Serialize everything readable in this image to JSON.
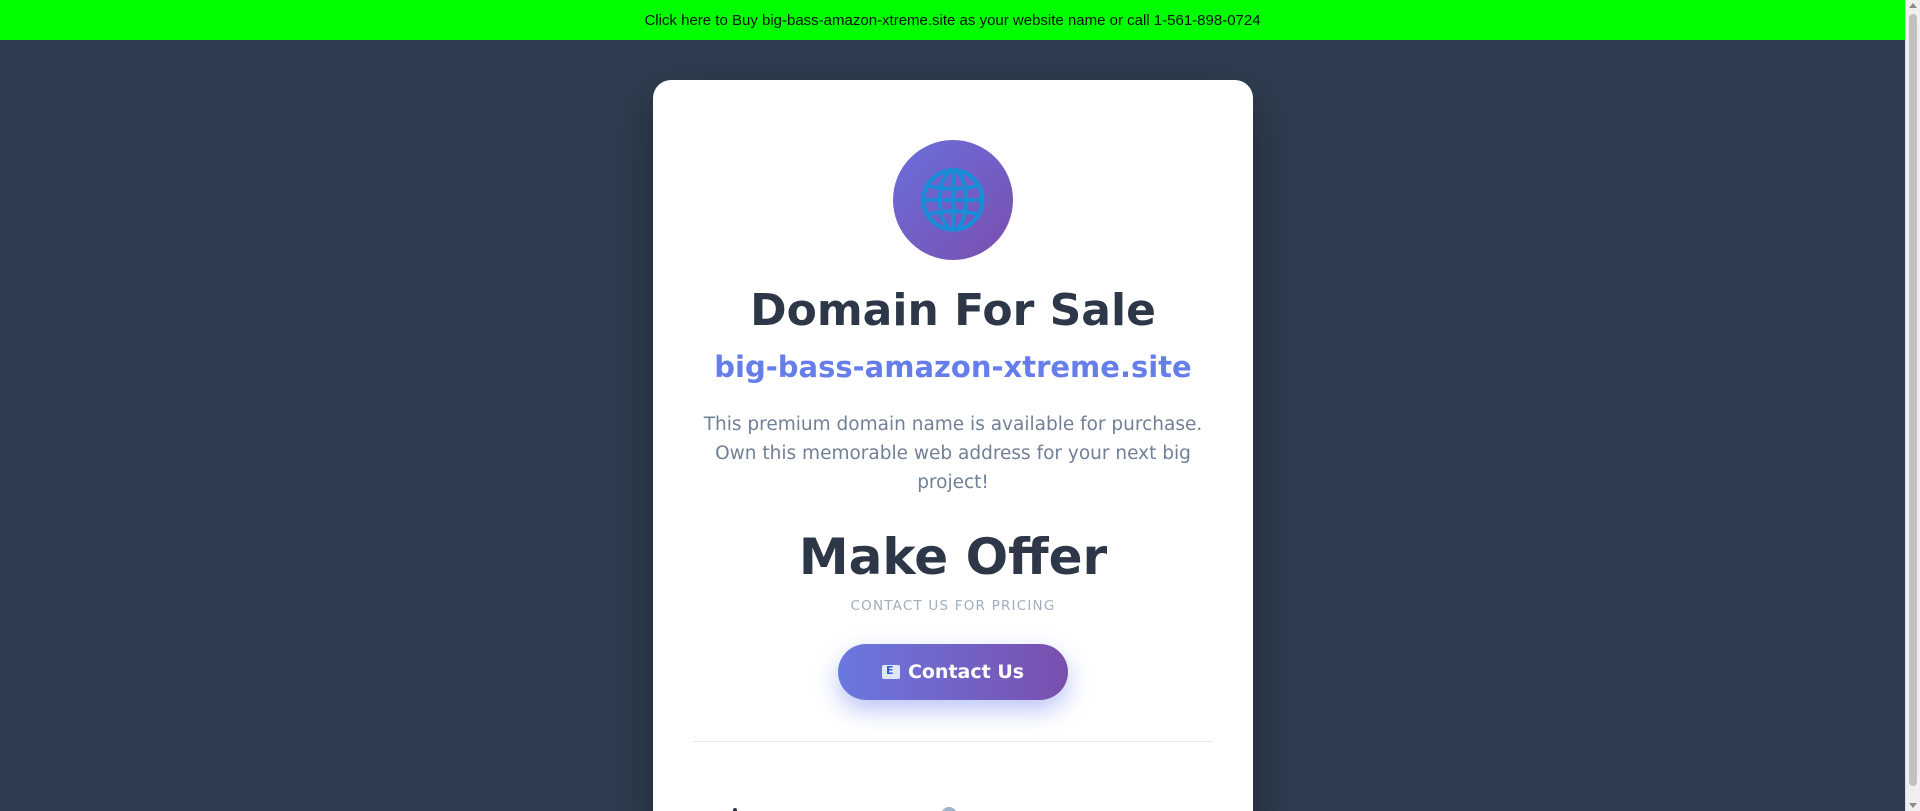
{
  "banner": {
    "text": "Click here to Buy big-bass-amazon-xtreme.site as your website name or call 1-561-898-0724",
    "color": "#00ff00"
  },
  "card": {
    "icon": "globe-icon",
    "title": "Domain For Sale",
    "domain": "big-bass-amazon-xtreme.site",
    "description": "This premium domain name is available for purchase. Own this memorable web address for your next big project!",
    "offer": "Make Offer",
    "pricing_note": "CONTACT US FOR PRICING",
    "contact_button": {
      "icon": "mail-icon",
      "label": "Contact Us"
    }
  },
  "colors": {
    "background": "#2e3d50",
    "accent": "#667eea",
    "accent_end": "#7a4fae",
    "heading": "#2d3748",
    "muted": "#718096"
  }
}
